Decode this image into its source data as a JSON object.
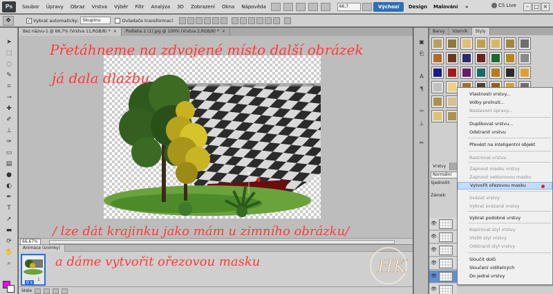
{
  "app": {
    "logo": "Ps"
  },
  "menubar": {
    "items": [
      "Soubor",
      "Úpravy",
      "Obraz",
      "Vrstva",
      "Výběr",
      "Filtr",
      "Analýza",
      "3D",
      "Zobrazení",
      "Okna",
      "Nápověda"
    ],
    "zoom": "66,7",
    "workspaces": [
      "Výchozí",
      "Design",
      "Malování"
    ],
    "active_workspace": "Výchozí",
    "cslive": "CS Live"
  },
  "options": {
    "auto_select_label": "Vybrat automaticky:",
    "auto_select_value": "Skupinu",
    "transform_label": "Ovladače transformací"
  },
  "documents": {
    "tabs": [
      "Bez názvu-1 @ 66,7% (Vrstva 11,RGB/8) *",
      "Podlaha 2 (1).jpg @ 100% (Vrstva 2,RGB/8) *"
    ],
    "zoom_status": "66,67%"
  },
  "annotations": {
    "line1": "Přetáhneme na zdvojené místo další obrázek",
    "line2": "já dala dlažbu",
    "line3": "/ lze dát krajinku jako mám u zimního obrázku/",
    "line4": "a dáme vytvořit ořezovou masku",
    "watermark": "HK"
  },
  "animation": {
    "tab": "Animace (snímky)",
    "frame_number": "1",
    "frame_time": "0 s",
    "loop": "Stále"
  },
  "panels": {
    "top_tabs": [
      "Barvy",
      "Vzorník",
      "Styly"
    ],
    "active_top_tab": "Styly",
    "layers_tab": "Vrstvy",
    "blend_mode": "Normální",
    "opacity_label": "Sjednotit:",
    "lock_label": "Zámek:"
  },
  "context_menu": {
    "items": [
      {
        "label": "Vlastnosti vrstvy...",
        "enabled": true
      },
      {
        "label": "Volby prolnutí...",
        "enabled": true
      },
      {
        "label": "Nastavení úpravy...",
        "enabled": false
      },
      {
        "label": "Duplikovat vrstvu...",
        "enabled": true
      },
      {
        "label": "Odstranit vrstvu",
        "enabled": true
      },
      {
        "label": "Převést na inteligentní objekt",
        "enabled": true
      },
      {
        "label": "Rastrovat vrstvu",
        "enabled": false
      },
      {
        "label": "Zapnout masku vrstvy",
        "enabled": false
      },
      {
        "label": "Zapnout vektorovou masku",
        "enabled": false
      },
      {
        "label": "Vytvořit ořezovou masku",
        "enabled": true,
        "highlighted": true
      },
      {
        "label": "Svázat vrstvy",
        "enabled": false
      },
      {
        "label": "Vybrat svázané vrstvy",
        "enabled": false
      },
      {
        "label": "Vybrat podobné vrstvy",
        "enabled": true
      },
      {
        "label": "Kopírovat styl vrstvy",
        "enabled": false
      },
      {
        "label": "Vložit styl vrstvy",
        "enabled": false
      },
      {
        "label": "Odstranit styl vrstvy",
        "enabled": false
      },
      {
        "label": "Sloučit dolů",
        "enabled": true
      },
      {
        "label": "Sloučení viditelných",
        "enabled": true
      },
      {
        "label": "Do jedné vrstvy",
        "enabled": true
      }
    ]
  },
  "colors": {
    "foreground": "#ff00ff",
    "background": "#ffffff",
    "annotation": "#ff3a3a",
    "highlight": "#c3dcf7"
  }
}
